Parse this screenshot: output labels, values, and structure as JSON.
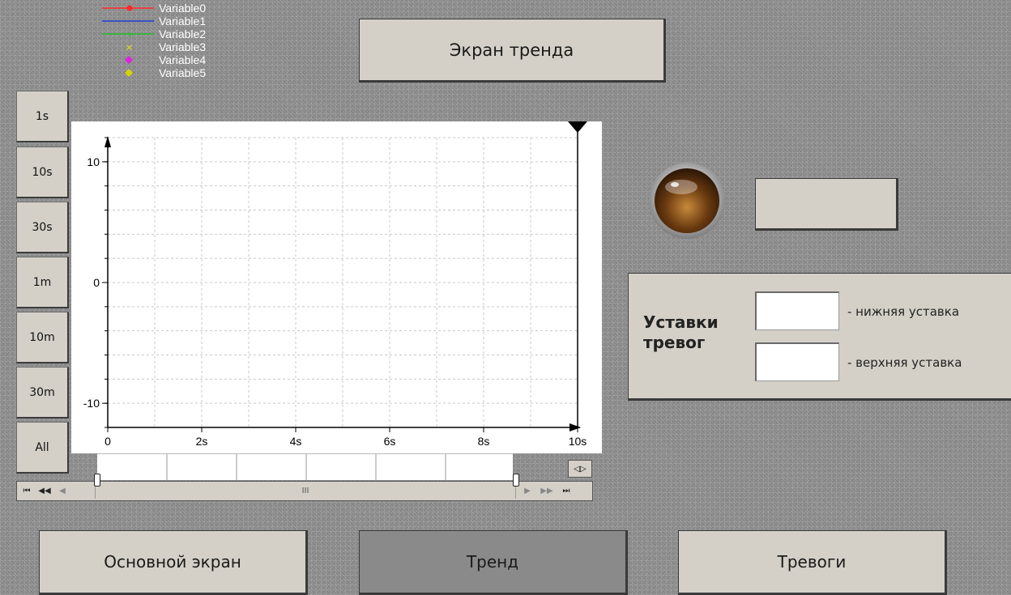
{
  "header": {
    "title": "Экран тренда"
  },
  "time_range_buttons": [
    "1s",
    "10s",
    "30s",
    "1m",
    "10m",
    "30m",
    "All"
  ],
  "legend": [
    {
      "label": "Variable0",
      "color": "#ff2a2a",
      "marker": "line-dot"
    },
    {
      "label": "Variable1",
      "color": "#1f3fd6",
      "marker": "line"
    },
    {
      "label": "Variable2",
      "color": "#22c02a",
      "marker": "line-plus"
    },
    {
      "label": "Variable3",
      "color": "#e6e600",
      "marker": "x"
    },
    {
      "label": "Variable4",
      "color": "#e020e0",
      "marker": "diamond"
    },
    {
      "label": "Variable5",
      "color": "#d4d400",
      "marker": "diamond"
    }
  ],
  "chart_data": {
    "type": "line",
    "x_ticks": [
      "0",
      "2s",
      "4s",
      "6s",
      "8s",
      "10s"
    ],
    "y_ticks": [
      "10",
      "0",
      "-10"
    ],
    "ylim": [
      -12,
      12
    ],
    "xlim": [
      0,
      10
    ],
    "grid": true,
    "series": []
  },
  "scrollbar": {
    "thumb_label": "III"
  },
  "alarm_setpoints": {
    "title_line1": "Уставки",
    "title_line2": "тревог",
    "low_label": "- нижняя уставка",
    "high_label": "- верхняя уставка",
    "low_value": "",
    "high_value": ""
  },
  "display": {
    "value": ""
  },
  "nav": {
    "main": "Основной экран",
    "trend": "Тренд",
    "alarms": "Тревоги"
  }
}
